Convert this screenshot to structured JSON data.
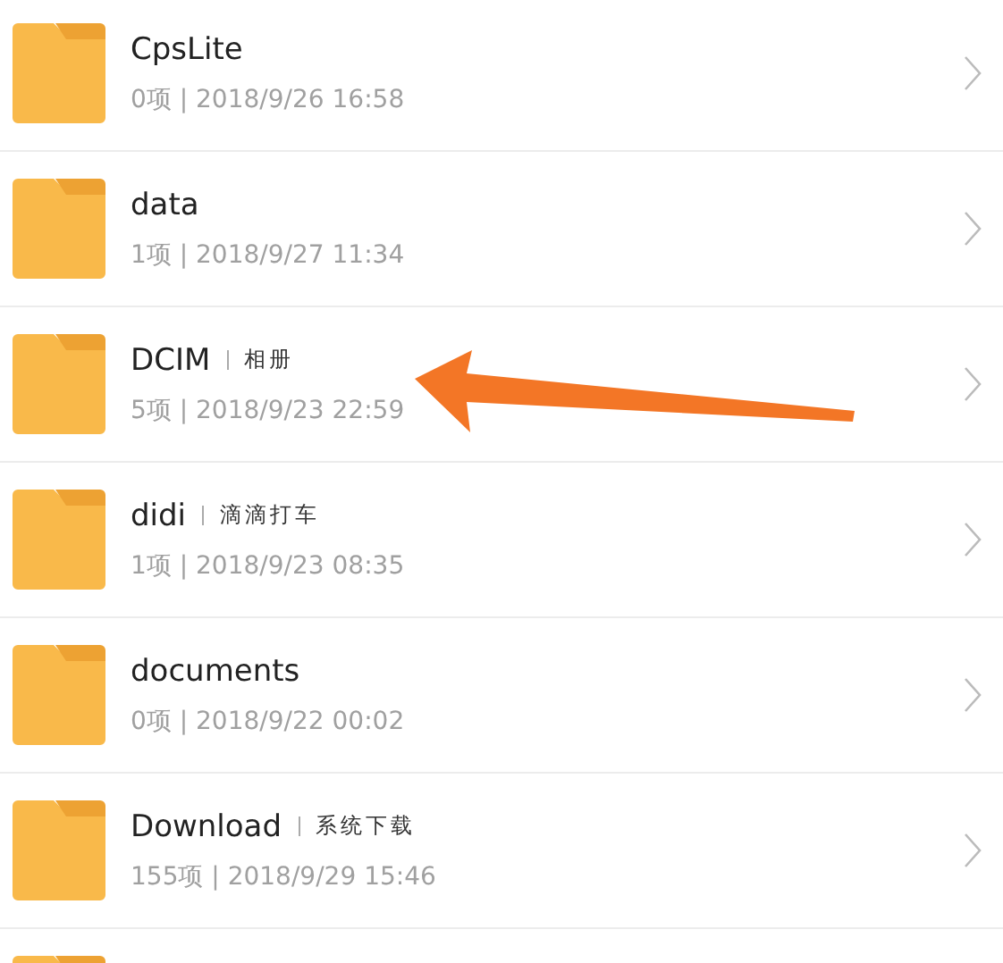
{
  "folders": [
    {
      "name": "CpsLite",
      "details": "0项 | 2018/9/26 16:58"
    },
    {
      "name": "data",
      "details": "1项 | 2018/9/27 11:34"
    },
    {
      "name": "DCIM",
      "tag": "相册",
      "details": "5项 | 2018/9/23 22:59"
    },
    {
      "name": "didi",
      "tag": "滴滴打车",
      "details": "1项 | 2018/9/23 08:35"
    },
    {
      "name": "documents",
      "details": "0项 | 2018/9/22 00:02"
    },
    {
      "name": "Download",
      "tag": "系统下载",
      "details": "155项 | 2018/9/29 15:46"
    }
  ],
  "more_below": true
}
